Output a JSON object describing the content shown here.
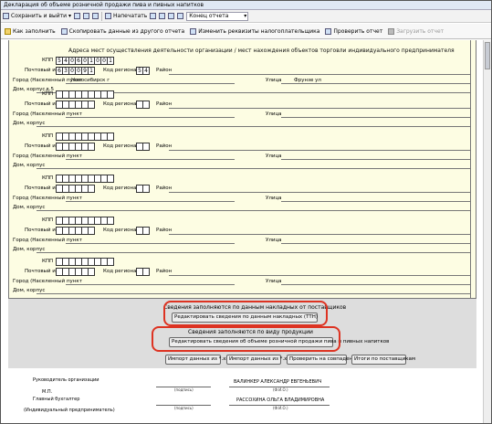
{
  "window": {
    "title": "Декларация об объеме розничной продажи пива и пивных напитков"
  },
  "toolbar1": {
    "save_exit": "Сохранить и выйти",
    "print": "Напечатать",
    "nav_select": "Конец отчета"
  },
  "toolbar2": {
    "how_fill": "Как заполнить",
    "copy_data": "Скопировать данные из другого отчета",
    "change_reqs": "Изменить реквизиты налогоплательщика",
    "check": "Проверить отчет",
    "submit": "Загрузить отчет"
  },
  "form": {
    "address_header": "Адреса мест осуществления деятельности организации / мест нахождения объектов торговли индивидуального предпринимателя",
    "labels": {
      "kpp": "КПП",
      "postal": "Почтовый индекс",
      "region": "Код региона",
      "district": "Район",
      "city": "Город (Населенный пункт",
      "street": "Улица",
      "house": "Дом, корпус"
    },
    "first_block": {
      "kpp": [
        "5",
        "4",
        "0",
        "6",
        "0",
        "1",
        "0",
        "0",
        "1"
      ],
      "postal": [
        "6",
        "3",
        "0",
        "0",
        "9",
        "1"
      ],
      "region": [
        "5",
        "4"
      ],
      "city": "Новосибирск г",
      "street": "Фрунзе ул",
      "house": "д.5"
    }
  },
  "lower": {
    "section1_title": "Сведения заполняются по данным накладных от поставщиков",
    "section1_button": "Редактировать сведения по данным накладных (ТТН)",
    "section2_title": "Сведения заполняются по виду продукции",
    "section2_button": "Редактировать сведения об объеме розничной продажи пива и пивных напитков",
    "import_xml": "Импорт данных из *.xml",
    "import_xls": "Импорт данных из *.xls",
    "check_match": "Проверить на совпадение",
    "totals": "Итоги по поставщикам"
  },
  "signatures": {
    "head_label": "Руководитель организации",
    "mp": "М.П.",
    "accountant_label": "Главный бухгалтер",
    "ip_label": "(Индивидуальный предприниматель)",
    "head_name": "ВАЛИНКЕР АЛЕКСАНДР ЕВГЕНЬЕВИЧ",
    "accountant_name": "РАССОХИНА ОЛЬГА ВЛАДИМИРОВНА",
    "signature_caption": "(подпись)",
    "fio_caption": "(Ф.И.О.)"
  },
  "colors": {
    "form_bg": "#fdfde3",
    "highlight": "#d32"
  }
}
